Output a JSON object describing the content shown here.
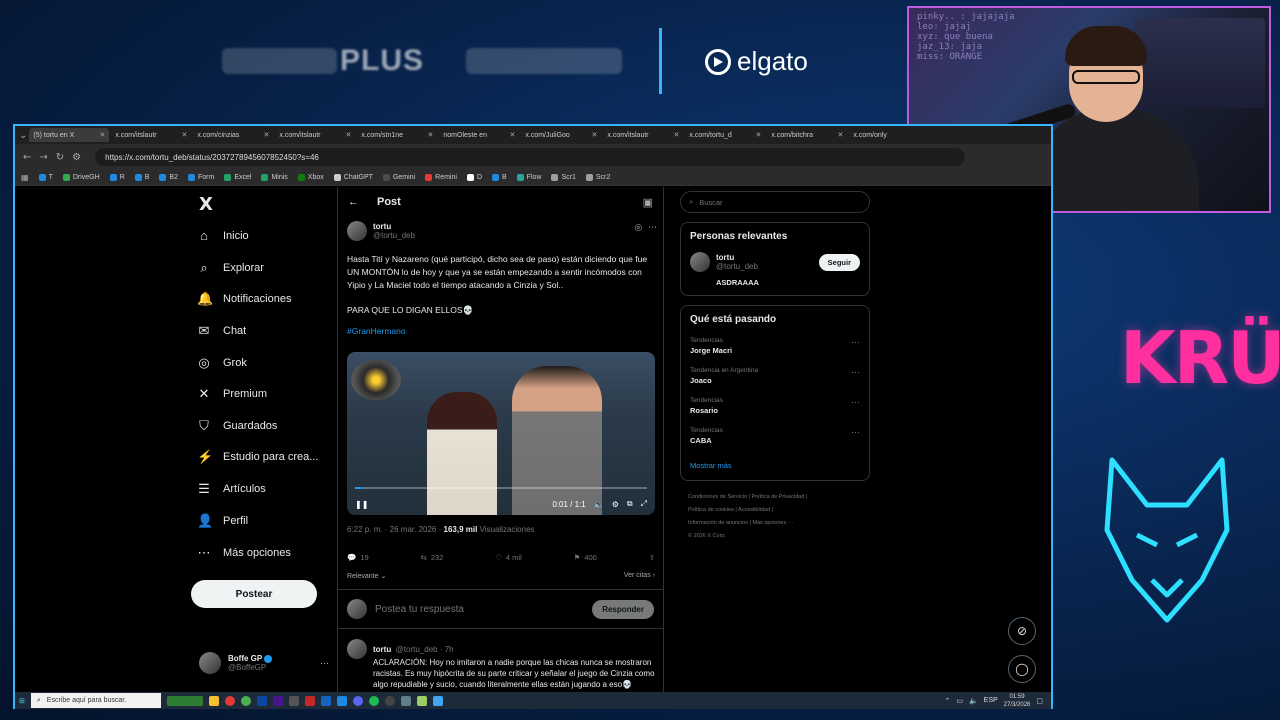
{
  "overlay": {
    "sponsor_plus": "PLUS",
    "elgato": "elgato"
  },
  "webcam": {
    "chat_lines": [
      "pinky.. : jajajaja",
      "leo: jajaj",
      "xyz: que buena",
      "jaz_13: jaja",
      "miss: ORANGE"
    ]
  },
  "side_logo": "KRÜ",
  "browser": {
    "tabs": [
      {
        "label": "(5) tortu en X",
        "active": true
      },
      {
        "label": "x.com/itslautr",
        "active": false
      },
      {
        "label": "x.com/cinzias",
        "active": false
      },
      {
        "label": "x.com/itslautr",
        "active": false
      },
      {
        "label": "x.com/stn1ne",
        "active": false
      },
      {
        "label": "nomOleste en",
        "active": false
      },
      {
        "label": "x.com/JuliGoo",
        "active": false
      },
      {
        "label": "x.com/itslautr",
        "active": false
      },
      {
        "label": "x.com/tortu_d",
        "active": false
      },
      {
        "label": "x.com/bitchra",
        "active": false
      },
      {
        "label": "x.com/only",
        "active": false
      }
    ],
    "url": "https://x.com/tortu_deb/status/2037278945607852450?s=46",
    "bookmarks": [
      {
        "label": "T",
        "color": "#1e88e5"
      },
      {
        "label": "DriveGH",
        "color": "#34a853"
      },
      {
        "label": "R",
        "color": "#1e88e5"
      },
      {
        "label": "B",
        "color": "#1e88e5"
      },
      {
        "label": "B2",
        "color": "#1e88e5"
      },
      {
        "label": "Form",
        "color": "#1e88e5"
      },
      {
        "label": "Excel",
        "color": "#21a366"
      },
      {
        "label": "Minis",
        "color": "#21a366"
      },
      {
        "label": "Xbox",
        "color": "#107c10"
      },
      {
        "label": "ChatGPT",
        "color": "#cccccc"
      },
      {
        "label": "Gemini",
        "color": "#4a4a4a"
      },
      {
        "label": "Remini",
        "color": "#e53935"
      },
      {
        "label": "D",
        "color": "#ffffff"
      },
      {
        "label": "B",
        "color": "#1e88e5"
      },
      {
        "label": "Flow",
        "color": "#26a69a"
      },
      {
        "label": "Scr1",
        "color": "#9e9e9e"
      },
      {
        "label": "Scr2",
        "color": "#9e9e9e"
      }
    ]
  },
  "nav": {
    "items": [
      {
        "label": "Inicio",
        "icon": "⌂"
      },
      {
        "label": "Explorar",
        "icon": "⌕"
      },
      {
        "label": "Notificaciones",
        "icon": "🔔"
      },
      {
        "label": "Chat",
        "icon": "✉"
      },
      {
        "label": "Grok",
        "icon": "◎"
      },
      {
        "label": "Premium",
        "icon": "✕"
      },
      {
        "label": "Guardados",
        "icon": "⛉"
      },
      {
        "label": "Estudio para crea...",
        "icon": "⚡"
      },
      {
        "label": "Artículos",
        "icon": "☰"
      },
      {
        "label": "Perfil",
        "icon": "👤"
      },
      {
        "label": "Más opciones",
        "icon": "⋯"
      }
    ],
    "post_button": "Postear",
    "me": {
      "name": "Boffe GP",
      "handle": "@BoffeGP"
    }
  },
  "main": {
    "header": "Post",
    "post": {
      "name": "tortu",
      "handle": "@tortu_deb",
      "text": "Hasta Tití y Nazareno (qué participó, dicho sea de paso) están diciendo que fue UN MONTÓN lo de hoy y  que ya se están empezando a sentir incómodos con Yipio y La Maciel todo el tiempo atacando a Cinzia y Sol..",
      "text2": "PARA QUE LO DIGAN ELLOS💀",
      "hashtag": "#GranHermano",
      "video_time": "0:01 / 1:1",
      "video_progress": 0.02,
      "date": "6:22 p. m. · 26 mar. 2026 · ",
      "views": "163,9 mil",
      "views_label": " Visualizaciones",
      "replies": "19",
      "reposts": "232",
      "likes": "4 mil",
      "bookmarks": "400",
      "sort": "Relevante",
      "quotes": "Ver citas"
    },
    "reply_placeholder": "Postea tu respuesta",
    "reply_button": "Responder",
    "reply": {
      "name": "tortu",
      "handle": "@tortu_deb · 7h",
      "text": "ACLARACIÓN: Hoy no imitaron a nadie porque las chicas nunca se mostraron racistas. Es muy hipócrita de su parte criticar y señalar el juego de Cinzia como algo repudiable y sucio, cuando literalmente ellas están jugando a eso💀"
    }
  },
  "right": {
    "search_placeholder": "Buscar",
    "relevant_title": "Personas relevantes",
    "relevant_person": {
      "name": "tortu",
      "handle": "@tortu_deb",
      "bio": "ASDRAAAA",
      "follow": "Seguir"
    },
    "trends_title": "Qué está pasando",
    "trends": [
      {
        "category": "Tendencias",
        "name": "Jorge Macri"
      },
      {
        "category": "Tendencia en Argentina",
        "name": "Joaco"
      },
      {
        "category": "Tendencias",
        "name": "Rosario"
      },
      {
        "category": "Tendencias",
        "name": "CABA"
      }
    ],
    "show_more": "Mostrar más",
    "footer": [
      "Condiciones de Servicio  |  Política de Privacidad  |",
      "Política de cookies  |  Accesibilidad  |",
      "Información de anuncios  |  Más opciones ···",
      "© 2026 X Corp."
    ]
  },
  "taskbar": {
    "search": "Escribe aquí para buscar.",
    "lang": "ESP",
    "time": "01:59",
    "date": "27/3/2026"
  }
}
